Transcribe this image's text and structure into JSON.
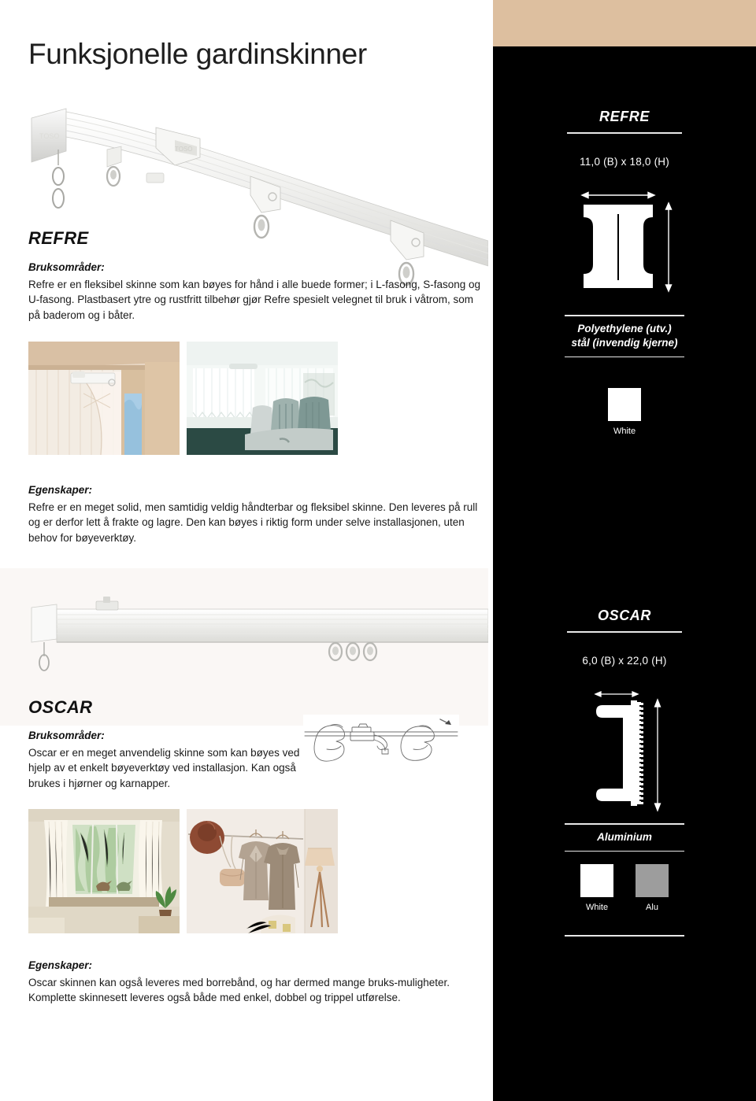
{
  "page": {
    "title": "Funksjonelle gardinskinner",
    "accent_beige": "#ddbf9f",
    "panel_black": "#000000"
  },
  "products": [
    {
      "id": "refre",
      "name": "REFRE",
      "spec_name": "REFRE",
      "dimensions": "11,0 (B) x 18,0 (H)",
      "material": "Polyethylene (utv.)\nstål (invendig kjerne)",
      "material_line1": "Polyethylene (utv.)",
      "material_line2": "stål (invendig kjerne)",
      "profile_type": "i-beam",
      "usage_label": "Bruksområder:",
      "usage_text": "Refre er en fleksibel skinne som kan bøyes for hånd i alle buede former; i L-fasong, S-fasong og U-fasong. Plastbasert ytre og rustfritt tilbehør gjør Refre spesielt velegnet til bruk i våtrom, som på baderom og i båter.",
      "properties_label": "Egenskaper:",
      "properties_text": "Refre er en meget solid, men samtidig veldig håndterbar og fleksibel skinne. Den leveres på rull og er derfor lett å frakte og lagre. Den kan bøyes i riktig form under selve installasjonen, uten behov for bøyeverktøy.",
      "colors": [
        {
          "label": "White",
          "hex": "#ffffff"
        }
      ],
      "photos": [
        {
          "alt": "curtain-rail-mounted-in-wooden-window-frame"
        },
        {
          "alt": "van-interior-with-curtains-and-bench-seat"
        }
      ]
    },
    {
      "id": "oscar",
      "name": "OSCAR",
      "spec_name": "OSCAR",
      "dimensions": "6,0 (B) x 22,0 (H)",
      "material": "Aluminium",
      "material_line1": "Aluminium",
      "material_line2": "",
      "profile_type": "c-channel",
      "usage_label": "Bruksområder:",
      "usage_text": "Oscar er en meget anvendelig skinne som kan bøyes ved hjelp av et enkelt bøyeverktøy ved installasjon. Kan også brukes i hjørner og karnapper.",
      "properties_label": "Egenskaper:",
      "properties_text": "Oscar skinnen kan også leveres med borrebånd, og har dermed mange bruks-muligheter. Komplette skinnesett leveres også både med enkel, dobbel og trippel utførelse.",
      "colors": [
        {
          "label": "White",
          "hex": "#ffffff"
        },
        {
          "label": "Alu",
          "hex": "#9d9d9d"
        }
      ],
      "photos": [
        {
          "alt": "bay-window-with-sheer-curtains-and-plant"
        },
        {
          "alt": "wall-rail-with-hanging-coats-hat-bag-and-floor-lamp"
        }
      ],
      "diagram_alt": "two-hands-bending-rail-with-tool"
    }
  ]
}
